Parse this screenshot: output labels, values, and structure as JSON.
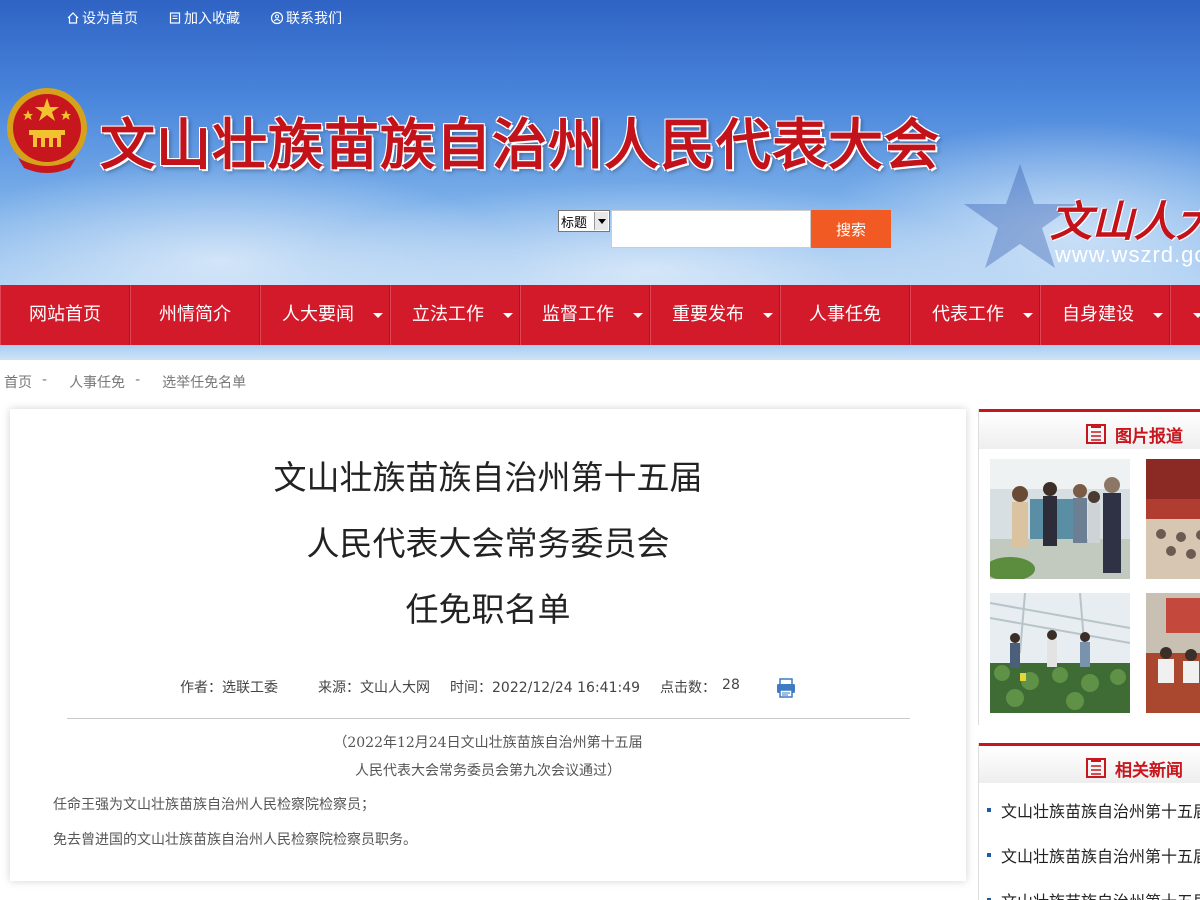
{
  "top_links": [
    {
      "label": "设为首页",
      "icon": "home-icon"
    },
    {
      "label": "加入收藏",
      "icon": "bookmark-icon"
    },
    {
      "label": "联系我们",
      "icon": "contact-icon"
    }
  ],
  "header": {
    "site_title": "文山壮族苗族自治州人民代表大会",
    "calligraphy_text": "文山人大",
    "site_url": "www.wszrd.gov.cn"
  },
  "search": {
    "select_value": "标题",
    "input_value": "",
    "button_label": "搜索"
  },
  "nav": {
    "items": [
      {
        "label": "网站首页",
        "has_submenu": false
      },
      {
        "label": "州情简介",
        "has_submenu": false
      },
      {
        "label": "人大要闻",
        "has_submenu": true
      },
      {
        "label": "立法工作",
        "has_submenu": true
      },
      {
        "label": "监督工作",
        "has_submenu": true
      },
      {
        "label": "重要发布",
        "has_submenu": true
      },
      {
        "label": "人事任免",
        "has_submenu": false
      },
      {
        "label": "代表工作",
        "has_submenu": true
      },
      {
        "label": "自身建设",
        "has_submenu": true
      }
    ]
  },
  "breadcrumb": {
    "items": [
      "首页",
      "人事任免",
      "选举任免名单"
    ],
    "separator": "-"
  },
  "article": {
    "title_lines": [
      "文山壮族苗族自治州第十五届",
      "人民代表大会常务委员会",
      "任免职名单"
    ],
    "meta": {
      "author": "作者：选联工委",
      "source": "来源：文山人大网",
      "time": "时间：2022/12/24 16:41:49",
      "clicks_label": "点击数：",
      "clicks": "28"
    },
    "intro_lines": [
      "（2022年12月24日文山壮族苗族自治州第十五届",
      "人民代表大会常务委员会第九次会议通过）"
    ],
    "paragraphs": [
      "任命王强为文山壮族苗族自治州人民检察院检察员；",
      "免去曾进国的文山壮族苗族自治州人民检察院检察员职务。"
    ]
  },
  "sidebar": {
    "photo_title": "图片报道",
    "news_title": "相关新闻",
    "news_items": [
      "文山壮族苗族自治州第十五届",
      "文山壮族苗族自治州第十五届",
      "文山壮族苗族自治州第十五届"
    ]
  },
  "colors": {
    "nav_red": "#d31a2b",
    "title_red": "#c4121b",
    "search_button": "#f15a22",
    "sidebar_accent": "#c8161e"
  }
}
